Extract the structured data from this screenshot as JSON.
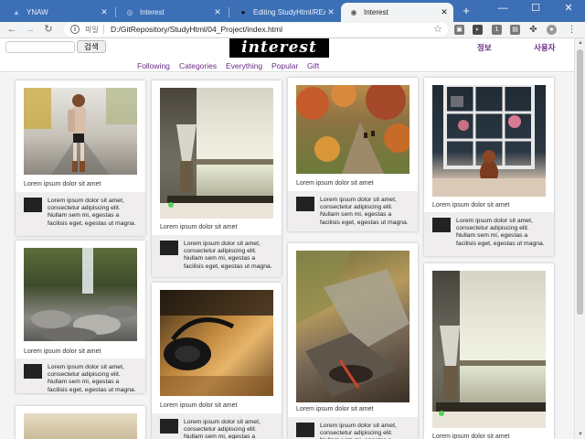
{
  "browser": {
    "tabs": [
      {
        "title": "YNAW",
        "active": false
      },
      {
        "title": "Interest",
        "active": false
      },
      {
        "title": "Editing StudyHtml/REA",
        "active": false
      },
      {
        "title": "Interest",
        "active": true
      }
    ],
    "new_tab": "+",
    "window_controls": [
      "—",
      "☐",
      "✕"
    ],
    "address": {
      "scheme_label": "파일",
      "url": "D:/GitRepository/StudyHtml/04_Project/index.html"
    }
  },
  "header": {
    "search_placeholder": "",
    "search_button": "검색",
    "logo": "interest",
    "links": [
      "정보",
      "사용자"
    ]
  },
  "menu": [
    "Following",
    "Categories",
    "Everything",
    "Popular",
    "Gift"
  ],
  "cards": {
    "caption": "Lorem ipsum dolor sit amet",
    "description": "Lorem ipsum dolor sit amet, consectetur adipiscing elit. Nullam sem mi, egestas a facilisis eget, egestas ut magna."
  }
}
